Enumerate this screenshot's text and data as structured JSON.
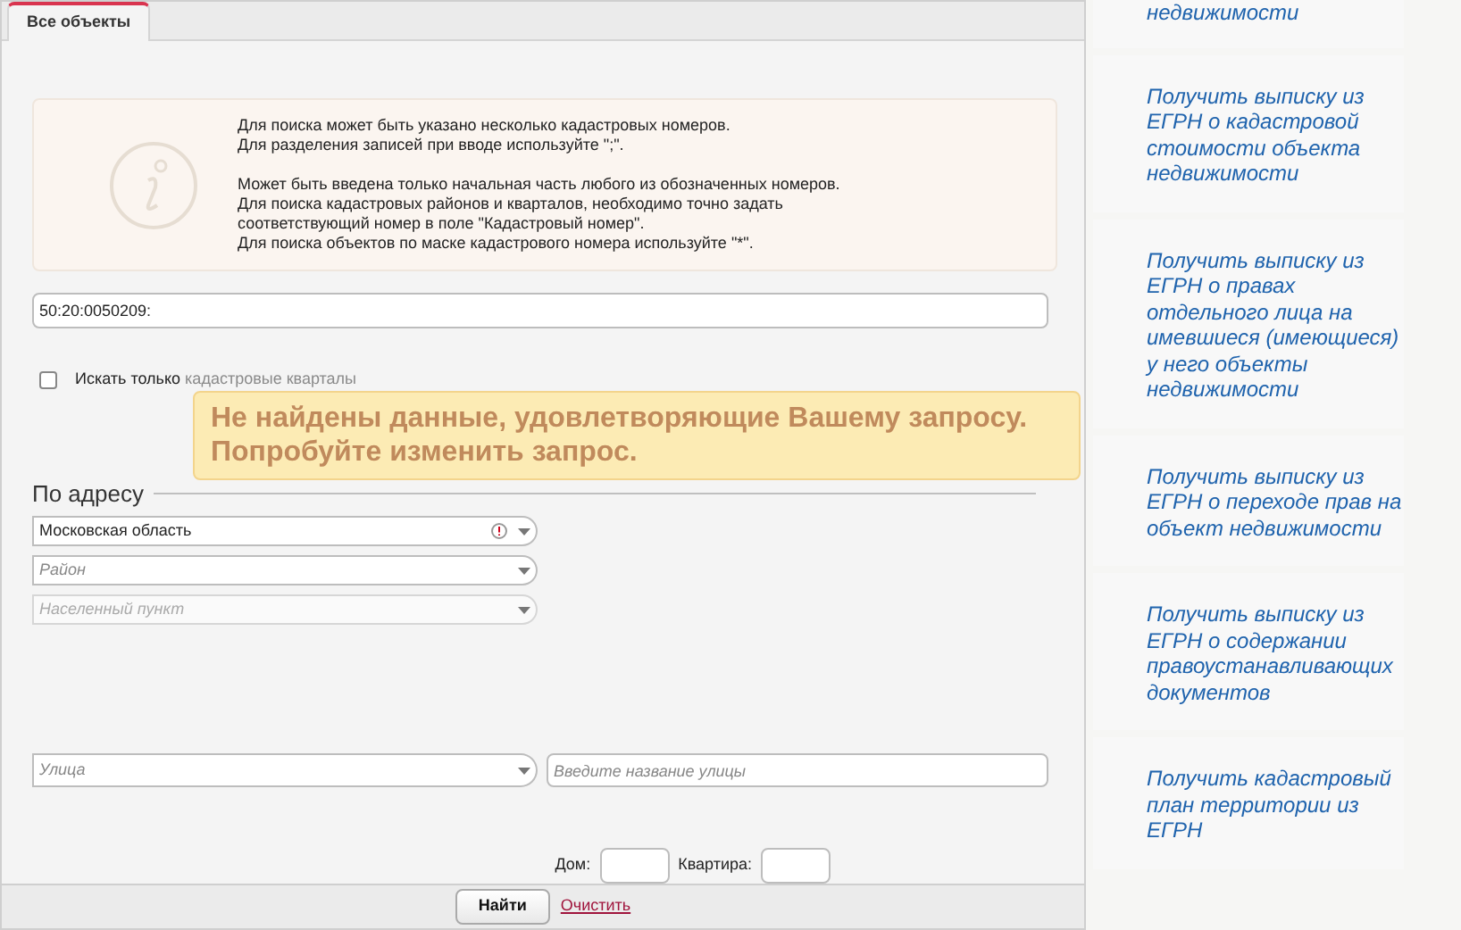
{
  "tabs": [
    {
      "label": "Все объекты",
      "selected": true
    }
  ],
  "info": {
    "paragraphs": [
      [
        "Для поиска может быть указано несколько кадастровых номеров.",
        "Для разделения записей при вводе используйте \";\"."
      ],
      [
        "Может быть введена только начальная часть любого из обозначенных номеров.",
        "Для поиска кадастровых районов и кварталов, необходимо точно задать соответствующий номер в поле \"Кадастровый номер\".",
        "Для поиска объектов по маске кадастрового номера используйте \"*\"."
      ]
    ]
  },
  "cadastral_number": {
    "value": "50:20:0050209:"
  },
  "only_quarters": {
    "label_bold": "Искать только",
    "label_faded": "кадастровые кварталы",
    "checked": false
  },
  "address": {
    "heading": "По адресу",
    "selects": [
      {
        "value": "Московская область",
        "error": true,
        "disabled": false
      },
      {
        "placeholder": "Район",
        "error": false,
        "disabled": false
      },
      {
        "placeholder": "Населенный пункт",
        "error": false,
        "disabled": true
      }
    ],
    "street_select": {
      "placeholder": "Улица"
    },
    "street_name": {
      "placeholder": "Введите название улицы"
    },
    "house_label": "Дом:",
    "flat_label": "Квартира:"
  },
  "footer": {
    "find": "Найти",
    "clear": "Очистить"
  },
  "notice": {
    "lines": [
      "Не найдены данные, удовлетворяющие Вашему запросу.",
      "Попробуйте изменить запрос."
    ]
  },
  "sidebar_links": [
    {
      "text": "недвижимости"
    },
    {
      "text": "Получить выписку из ЕГРН о кадастровой стоимости объекта недвижимости"
    },
    {
      "text": "Получить выписку из ЕГРН о правах отдельного лица на имевшиеся (имеющиеся) у него объекты недвижимости"
    },
    {
      "text": "Получить выписку из ЕГРН о переходе прав на объект недвижимости"
    },
    {
      "text": "Получить выписку из ЕГРН о содержании правоустанавливающих документов"
    },
    {
      "text": "Получить кадастровый план территории из ЕГРН"
    }
  ]
}
